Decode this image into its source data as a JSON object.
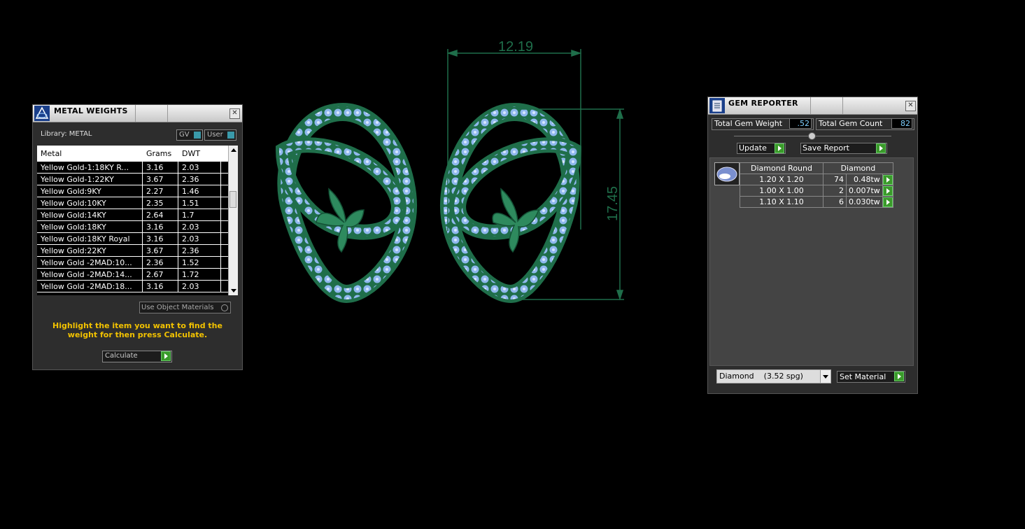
{
  "metal_weights": {
    "title": "METAL WEIGHTS",
    "library_label": "Library: METAL",
    "gv_label": "GV",
    "user_label": "User",
    "columns": [
      "Metal",
      "Grams",
      "DWT"
    ],
    "rows": [
      {
        "metal": "Yellow Gold-1:18KY R...",
        "grams": "3.16",
        "dwt": "2.03"
      },
      {
        "metal": "Yellow Gold-1:22KY",
        "grams": "3.67",
        "dwt": "2.36"
      },
      {
        "metal": "Yellow Gold:9KY",
        "grams": "2.27",
        "dwt": "1.46"
      },
      {
        "metal": "Yellow Gold:10KY",
        "grams": "2.35",
        "dwt": "1.51"
      },
      {
        "metal": "Yellow Gold:14KY",
        "grams": "2.64",
        "dwt": "1.7"
      },
      {
        "metal": "Yellow Gold:18KY",
        "grams": "3.16",
        "dwt": "2.03"
      },
      {
        "metal": "Yellow Gold:18KY Royal",
        "grams": "3.16",
        "dwt": "2.03"
      },
      {
        "metal": "Yellow Gold:22KY",
        "grams": "3.67",
        "dwt": "2.36"
      },
      {
        "metal": "Yellow Gold -2MAD:10...",
        "grams": "2.36",
        "dwt": "1.52"
      },
      {
        "metal": "Yellow Gold -2MAD:14...",
        "grams": "2.67",
        "dwt": "1.72"
      },
      {
        "metal": "Yellow Gold -2MAD:18...",
        "grams": "3.16",
        "dwt": "2.03"
      }
    ],
    "use_object_materials": "Use Object Materials",
    "instructions": "Highlight the item you want to find the weight for then press Calculate.",
    "calculate_label": "Calculate"
  },
  "dimensions": {
    "width": "12.19",
    "height": "17.45"
  },
  "gem_reporter": {
    "title": "GEM REPORTER",
    "total_gem_weight_label": "Total Gem Weight",
    "total_gem_weight": ".52",
    "total_gem_count_label": "Total Gem Count",
    "total_gem_count": "82",
    "update_label": "Update",
    "save_report_label": "Save Report",
    "table_header_shape": "Diamond Round",
    "table_header_material": "Diamond",
    "rows": [
      {
        "size": "1.20 X 1.20",
        "count": "74",
        "weight": "0.48tw"
      },
      {
        "size": "1.00 X 1.00",
        "count": "2",
        "weight": "0.007tw"
      },
      {
        "size": "1.10 X 1.10",
        "count": "6",
        "weight": "0.030tw"
      }
    ],
    "material_select": "Diamond    (3.52 spg)",
    "set_material_label": "Set Material"
  },
  "colors": {
    "dimension_green": "#1f6e4a",
    "accent_green": "#3a9a2a",
    "instruction_yellow": "#f2c200",
    "value_cyan": "#7fd0ff"
  }
}
